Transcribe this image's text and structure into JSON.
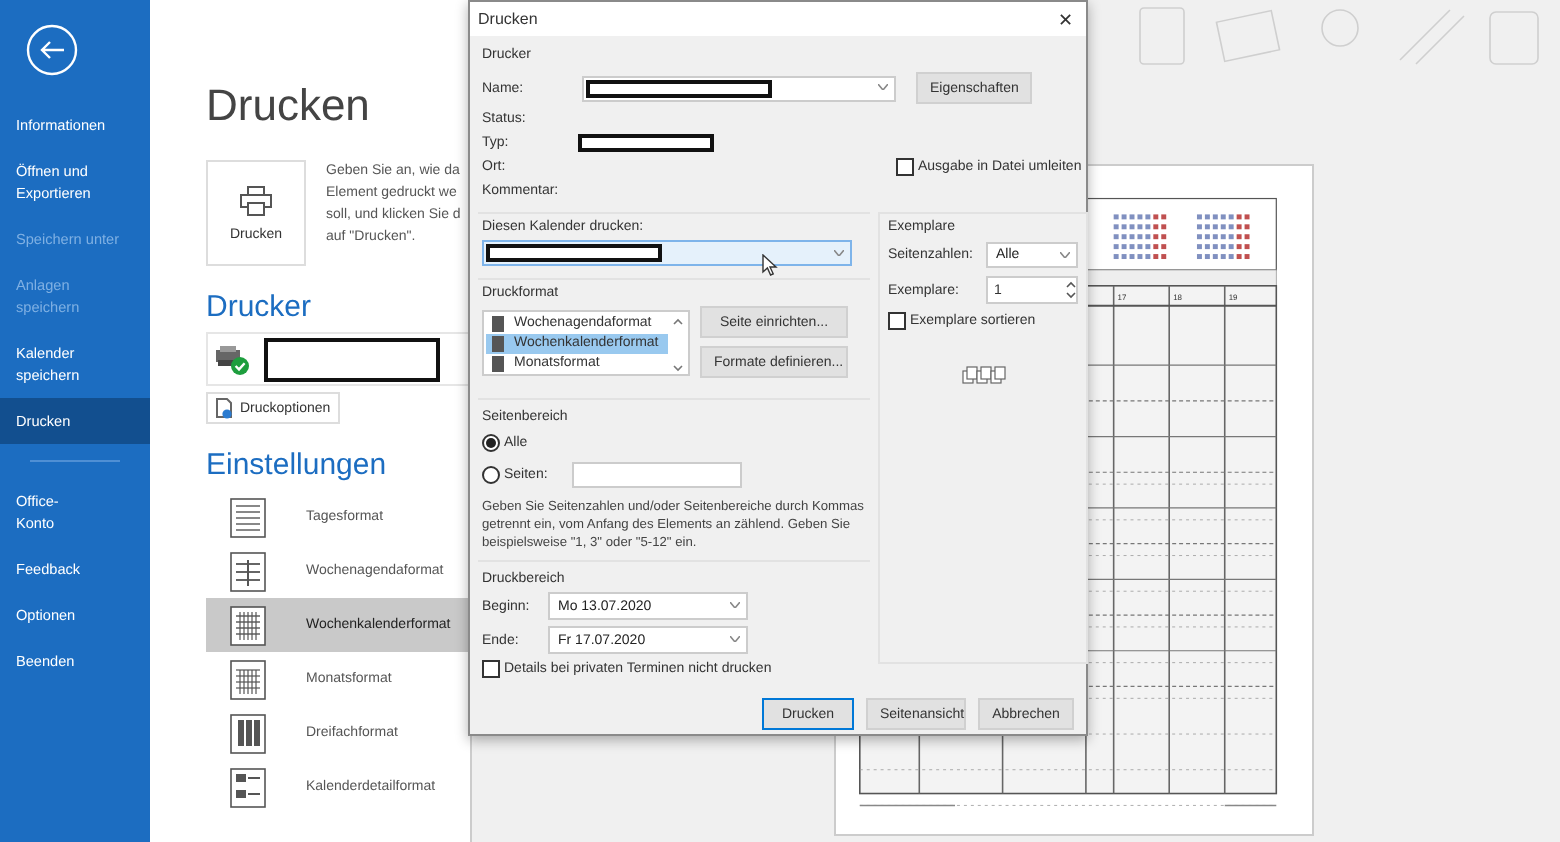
{
  "sidebar": {
    "items": [
      {
        "label": "Informationen",
        "selected": false,
        "disabled": false
      },
      {
        "label": "Öffnen und Exportieren",
        "selected": false,
        "disabled": false
      },
      {
        "label": "Speichern unter",
        "selected": false,
        "disabled": true
      },
      {
        "label": "Anlagen speichern",
        "selected": false,
        "disabled": true
      },
      {
        "label": "Kalender speichern",
        "selected": false,
        "disabled": false
      },
      {
        "label": "Drucken",
        "selected": true,
        "disabled": false
      }
    ],
    "footer_items": [
      {
        "label": "Office-Konto",
        "selected": false,
        "disabled": false
      },
      {
        "label": "Feedback",
        "selected": false,
        "disabled": false
      },
      {
        "label": "Optionen",
        "selected": false,
        "disabled": false
      },
      {
        "label": "Beenden",
        "selected": false,
        "disabled": false
      }
    ]
  },
  "page": {
    "title": "Drucken",
    "print_button": "Drucken",
    "description": [
      "Geben Sie an, wie da",
      "Element gedruckt we",
      "soll, und klicken Sie d",
      "auf \"Drucken\"."
    ],
    "printer_heading": "Drucker",
    "printer_options_button": "Druckoptionen",
    "settings_heading": "Einstellungen",
    "formats": [
      {
        "label": "Tagesformat",
        "kind": "day",
        "selected": false
      },
      {
        "label": "Wochenagendaformat",
        "kind": "agenda",
        "selected": false
      },
      {
        "label": "Wochenkalenderformat",
        "kind": "week",
        "selected": true
      },
      {
        "label": "Monatsformat",
        "kind": "month",
        "selected": false
      },
      {
        "label": "Dreifachformat",
        "kind": "trifold",
        "selected": false
      },
      {
        "label": "Kalenderdetailformat",
        "kind": "detail",
        "selected": false
      }
    ]
  },
  "preview": {
    "day_numbers": [
      "17",
      "18",
      "19"
    ]
  },
  "dialog": {
    "title": "Drucken",
    "close": "✕",
    "printer": {
      "label": "Drucker",
      "name_label": "Name:",
      "properties_button": "Eigenschaften",
      "status_label": "Status:",
      "type_label": "Typ:",
      "location_label": "Ort:",
      "comment_label": "Kommentar:",
      "print_to_file": {
        "label": "Ausgabe in Datei umleiten",
        "checked": false
      }
    },
    "calendar": {
      "label": "Diesen Kalender drucken:"
    },
    "print_style": {
      "label": "Druckformat",
      "items": [
        {
          "label": "Wochenagendaformat",
          "selected": false
        },
        {
          "label": "Wochenkalenderformat",
          "selected": true
        },
        {
          "label": "Monatsformat",
          "selected": false
        }
      ],
      "page_setup_button": "Seite einrichten...",
      "define_styles_button": "Formate definieren..."
    },
    "page_range": {
      "label": "Seitenbereich",
      "options": [
        {
          "label": "Alle",
          "selected": true
        },
        {
          "label": "Seiten:",
          "selected": false
        }
      ],
      "help": "Geben Sie Seitenzahlen und/oder Seitenbereiche durch Kommas getrennt ein, vom Anfang des Elements an zählend. Geben Sie beispielsweise \"1, 3\" oder \"5-12\" ein."
    },
    "print_range": {
      "label": "Druckbereich",
      "start_label": "Beginn:",
      "start_value": "Mo 13.07.2020",
      "end_label": "Ende:",
      "end_value": "Fr 17.07.2020",
      "hide_private": {
        "label": "Details bei privaten Terminen nicht drucken",
        "checked": false
      }
    },
    "copies": {
      "label": "Exemplare",
      "pages_label": "Seitenzahlen:",
      "pages_value": "Alle",
      "copies_label": "Exemplare:",
      "copies_value": "1",
      "collate": {
        "label": "Exemplare sortieren",
        "checked": false
      }
    },
    "buttons": [
      {
        "label": "Drucken",
        "default": true
      },
      {
        "label": "Seitenansicht",
        "default": false
      },
      {
        "label": "Abbrechen",
        "default": false
      }
    ]
  }
}
